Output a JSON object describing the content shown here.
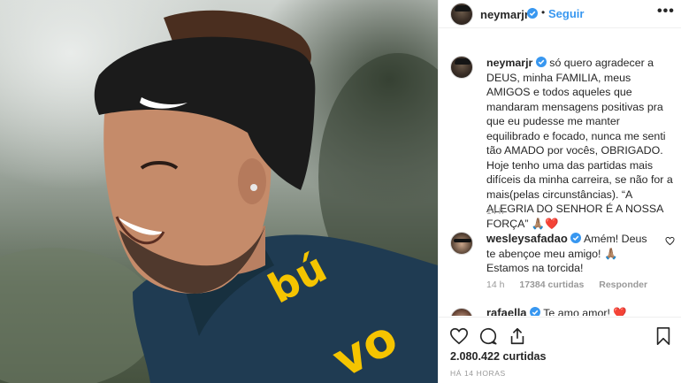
{
  "post": {
    "username": "neymarjr",
    "follow_label": "Seguir",
    "separator": "•",
    "more_label": "•••",
    "caption_text": "só quero agradecer a DEUS, minha FAMILIA, meus AMIGOS e todos aqueles que mandaram mensagens positivas pra que eu pudesse me manter equilibrado e focado, nunca me senti tão AMADO por vocês, OBRIGADO. Hoje tenho uma das partidas mais difíceis da minha carreira, se não for a mais(pelas circunstâncias). “A ALEGRIA DO SENHOR É A NOSSA FORÇA” 🙏🏽❤️",
    "caption_time": "14 h",
    "likes_text": "2.080.422 curtidas",
    "time_ago": "HÁ 14 HORAS"
  },
  "comments": [
    {
      "username": "wesleysafadao",
      "text": "Amém! Deus te abençoe meu amigo! 🙏🏽 Estamos na torcida!",
      "time": "14 h",
      "likes": "17384 curtidas",
      "reply": "Responder"
    },
    {
      "username": "rafaella",
      "text": "Te amo amor! ❤️"
    }
  ],
  "icons": {
    "verified": "verified-badge-icon",
    "like": "heart-outline-icon",
    "comment": "comment-bubble-icon",
    "share": "share-icon",
    "save": "bookmark-icon"
  },
  "colors": {
    "accent": "#3897f0",
    "meta_text": "#999999",
    "jersey": "#1f3b52",
    "jersey_lettering": "#f5c400",
    "headband": "#1b1b1b"
  }
}
